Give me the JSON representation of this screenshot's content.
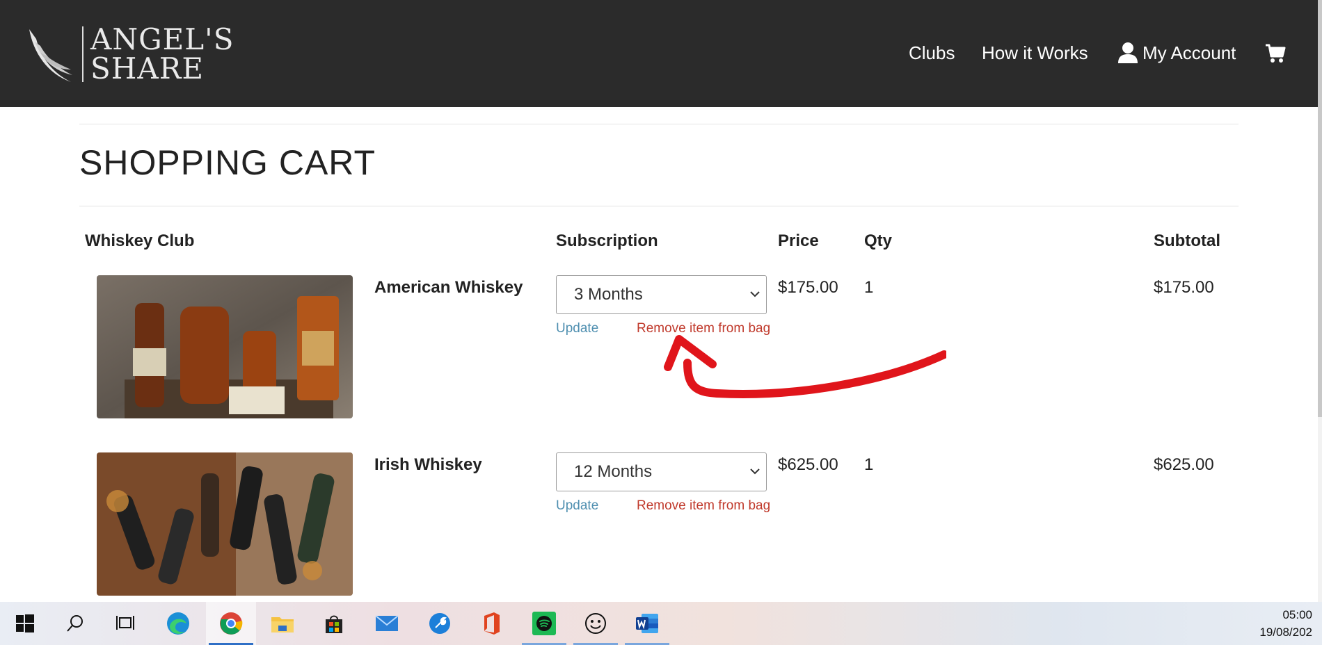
{
  "header": {
    "logo_text": [
      "ANGEL'S",
      "SHARE"
    ],
    "nav": {
      "clubs": "Clubs",
      "how_it_works": "How it Works",
      "my_account": "My Account"
    }
  },
  "page": {
    "title": "SHOPPING CART"
  },
  "table": {
    "headers": {
      "club": "Whiskey Club",
      "subscription": "Subscription",
      "price": "Price",
      "qty": "Qty",
      "subtotal": "Subtotal"
    },
    "rows": [
      {
        "name": "American Whiskey",
        "subscription": "3 Months",
        "price": "$175.00",
        "qty": "1",
        "subtotal": "$175.00",
        "update": "Update",
        "remove": "Remove item from bag"
      },
      {
        "name": "Irish Whiskey",
        "subscription": "12 Months",
        "price": "$625.00",
        "qty": "1",
        "subtotal": "$625.00",
        "update": "Update",
        "remove": "Remove item from bag"
      }
    ]
  },
  "taskbar": {
    "apps": [
      "start-icon",
      "search-icon",
      "task-view-icon",
      "edge-icon",
      "chrome-icon",
      "file-explorer-icon",
      "store-icon",
      "mail-icon",
      "settings-tool-icon",
      "office-icon",
      "spotify-icon",
      "emoji-app-icon",
      "word-icon"
    ],
    "clock": {
      "time": "05:00",
      "date": "19/08/202"
    }
  },
  "colors": {
    "nav_bg": "#2b2b2b",
    "update_link": "#4f8fb0",
    "remove_link": "#c0392b",
    "annotation": "#e0151b"
  }
}
